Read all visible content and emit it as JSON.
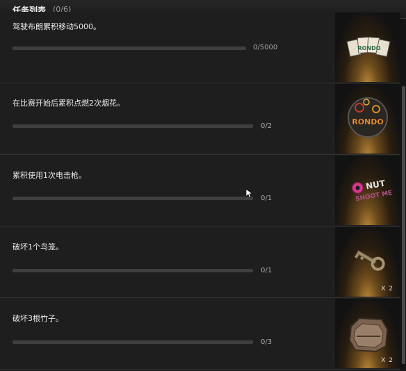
{
  "header": {
    "title": "任务列表",
    "count": "(0/6)"
  },
  "tasks": [
    {
      "text": "驾驶布朗累积移动5000。",
      "progress": "0/5000",
      "fraction": 0,
      "reward": "rondo-cards-icon",
      "qty": ""
    },
    {
      "text": "在比赛开始后累积点燃2次烟花。",
      "progress": "0/2",
      "fraction": 0,
      "reward": "rondo-firework-emblem-icon",
      "qty": ""
    },
    {
      "text": "累积使用1次电击枪。",
      "progress": "0/1",
      "fraction": 0,
      "reward": "donut-shoot-me-graffiti-icon",
      "qty": ""
    },
    {
      "text": "破坏1个鸟笼。",
      "progress": "0/1",
      "fraction": 0,
      "reward": "key-icon",
      "qty": "X 2"
    },
    {
      "text": "破坏3根竹子。",
      "progress": "0/3",
      "fraction": 0,
      "reward": "treasure-case-icon",
      "qty": "X 2"
    }
  ],
  "colors": {
    "background": "#1a1a1a",
    "bar_track": "#3f3f3f",
    "accent_gold": "#c9a24a"
  }
}
